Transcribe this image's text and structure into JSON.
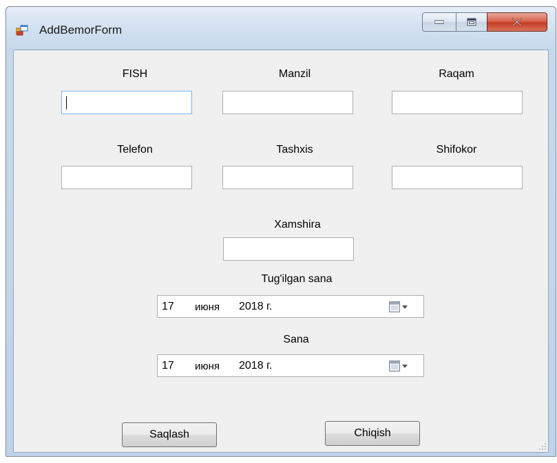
{
  "window": {
    "title": "AddBemorForm"
  },
  "fields": {
    "fish": {
      "label": "FISH",
      "value": ""
    },
    "manzil": {
      "label": "Manzil",
      "value": ""
    },
    "raqam": {
      "label": "Raqam",
      "value": ""
    },
    "telefon": {
      "label": "Telefon",
      "value": ""
    },
    "tashxis": {
      "label": "Tashxis",
      "value": ""
    },
    "shifokor": {
      "label": "Shifokor",
      "value": ""
    },
    "xamshira": {
      "label": "Xamshira",
      "value": ""
    }
  },
  "dates": {
    "birth": {
      "label": "Tug'ilgan sana",
      "day": "17",
      "month": "июня",
      "year": "2018 г."
    },
    "sana": {
      "label": "Sana",
      "day": "17",
      "month": "июня",
      "year": "2018 г."
    }
  },
  "buttons": {
    "save": "Saqlash",
    "exit": "Chiqish"
  },
  "icons": {
    "app": "app-form-icon",
    "minimize": "minimize-icon",
    "maximize": "maximize-icon",
    "close": "close-icon",
    "calendar": "calendar-dropdown-icon"
  }
}
